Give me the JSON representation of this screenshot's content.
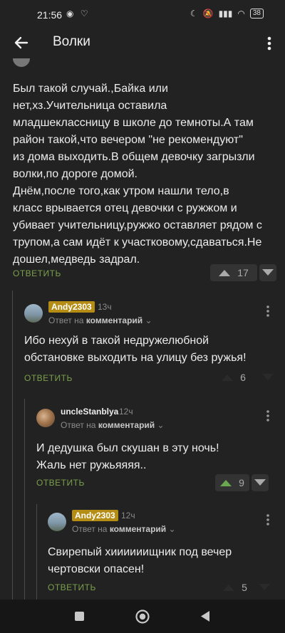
{
  "status_bar": {
    "time": "21:56",
    "battery": "38"
  },
  "app_bar": {
    "title": "Волки"
  },
  "comments": [
    {
      "text": "Был такой случай.,Байка или\nнет,хз.Учительница оставила\nмладшеклассницу в школе до темноты.А там\nрайон такой,что вечером \"не рекомендуют\"\nиз дома выходить.В общем девочку загрызли\nволки,по дороге домой.\nДнём,после того,как утром нашли тело,в\nкласс врывается отец девочки с ружжом и\nубивает учительницу,ружжо оставляет рядом с\nтрупом,а сам идёт к участковому,сдаваться.Не\nдошел,медведь задрал.",
      "reply_label": "ОТВЕТИТЬ",
      "votes": "17"
    },
    {
      "author": "Andy2303",
      "time": "13ч",
      "reply_prefix": "Ответ на",
      "reply_target": "комментарий",
      "text": "Ибо нехуй в такой недружелюбной\nобстановке выходить на улицу без ружья!",
      "reply_label": "ОТВЕТИТЬ",
      "votes": "6"
    },
    {
      "author": "uncleStanblya",
      "time": "12ч",
      "reply_prefix": "Ответ на",
      "reply_target": "комментарий",
      "text": "И дедушка был скушан в эту ночь!\nЖаль нет ружьяяяя..",
      "reply_label": "ОТВЕТИТЬ",
      "votes": "9"
    },
    {
      "author": "Andy2303",
      "time": "12ч",
      "reply_prefix": "Ответ на",
      "reply_target": "комментарий",
      "text": "Свирепый хиииииищник под вечер\nчертовски опасен!",
      "reply_label": "ОТВЕТИТЬ",
      "votes": "5"
    }
  ],
  "colors": {
    "background": "#222222",
    "accent_green": "#7aa04b",
    "author_badge": "#b58d14"
  },
  "icons": [
    "back-arrow-icon",
    "more-vert-icon",
    "vote-up-icon",
    "vote-down-icon",
    "chevron-down-icon",
    "nav-square-icon",
    "nav-circle-icon",
    "nav-back-icon"
  ]
}
